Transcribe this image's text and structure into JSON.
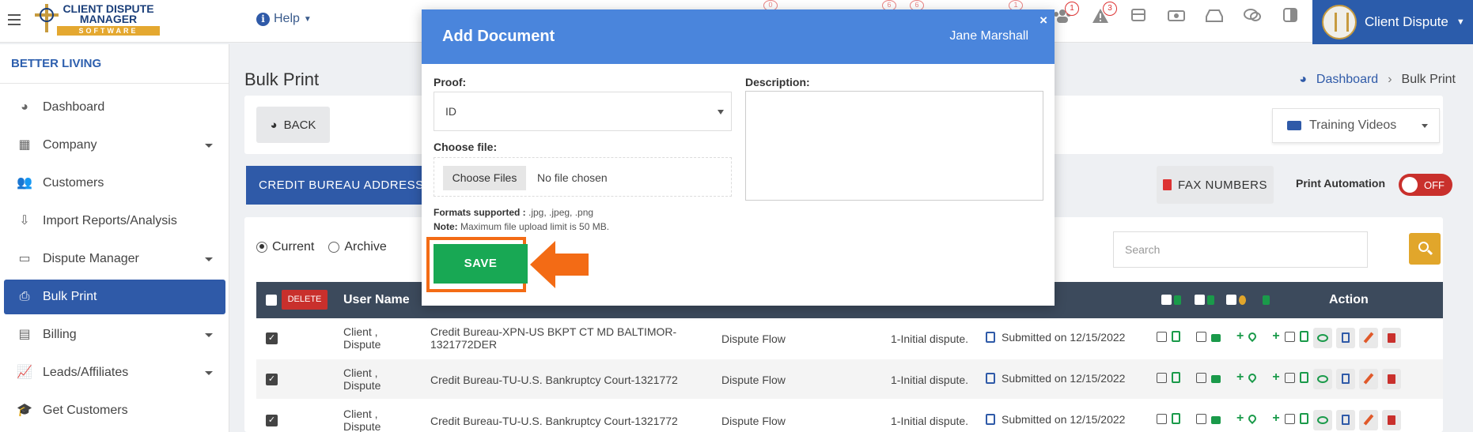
{
  "app": {
    "logo_line1": "CLIENT DISPUTE",
    "logo_line2": "MANAGER",
    "logo_line3": "SOFTWARE",
    "help_label": "Help",
    "user_name": "Client Dispute"
  },
  "topbar": {
    "badges": [
      "1",
      "3"
    ],
    "ghost_badges": [
      "0",
      "6",
      "6",
      "1"
    ],
    "icons": [
      "users-icon",
      "alert-icon",
      "archive-icon",
      "money-icon",
      "inbox-icon",
      "chat-icon",
      "collapse-icon"
    ]
  },
  "sidebar": {
    "org": "BETTER LIVING",
    "items": [
      {
        "label": "Dashboard",
        "icon": "pie-icon"
      },
      {
        "label": "Company",
        "icon": "building-icon",
        "has_caret": true
      },
      {
        "label": "Customers",
        "icon": "users-icon"
      },
      {
        "label": "Import Reports/Analysis",
        "icon": "import-icon"
      },
      {
        "label": "Dispute Manager",
        "icon": "monitor-icon",
        "has_caret": true
      },
      {
        "label": "Bulk Print",
        "icon": "printer-icon",
        "active": true
      },
      {
        "label": "Billing",
        "icon": "billing-icon",
        "has_caret": true
      },
      {
        "label": "Leads/Affiliates",
        "icon": "chart-icon",
        "has_caret": true
      },
      {
        "label": "Get Customers",
        "icon": "graduation-icon"
      }
    ]
  },
  "page": {
    "title": "Bulk Print",
    "breadcrumb": [
      "Dashboard",
      "Bulk Print"
    ],
    "back_label": "BACK",
    "training_label": "Training Videos",
    "bureau_label": "CREDIT BUREAU ADDRESS",
    "fax_label": "FAX NUMBERS",
    "automation_label": "Print Automation",
    "toggle_label": "OFF",
    "radio_current": "Current",
    "radio_archive": "Archive",
    "search_placeholder": "Search"
  },
  "table": {
    "delete_label": "DELETE",
    "header_user": "User Name",
    "header_action": "Action",
    "rows": [
      {
        "user": "Client , Dispute",
        "bureau": "Credit Bureau-XPN-US BKPT CT MD BALTIMOR-1321772DER",
        "flow": "Dispute Flow",
        "dispute": "1-Initial dispute.",
        "status": "Submitted on 12/15/2022"
      },
      {
        "user": "Client , Dispute",
        "bureau": "Credit Bureau-TU-U.S. Bankruptcy Court-1321772",
        "flow": "Dispute Flow",
        "dispute": "1-Initial dispute.",
        "status": "Submitted on 12/15/2022"
      },
      {
        "user": "Client , Dispute",
        "bureau": "Credit Bureau-TU-U.S. Bankruptcy Court-1321772",
        "flow": "Dispute Flow",
        "dispute": "1-Initial dispute.",
        "status": "Submitted on 12/15/2022"
      }
    ]
  },
  "modal": {
    "title": "Add Document",
    "user": "Jane Marshall",
    "close": "×",
    "proof_label": "Proof:",
    "proof_value": "ID",
    "description_label": "Description:",
    "choose_file_label": "Choose file:",
    "choose_files_button": "Choose Files",
    "no_file": "No file chosen",
    "formats_label": "Formats supported :",
    "formats_value": " .jpg, .jpeg, .png",
    "note_label": "Note:",
    "note_value": " Maximum file upload limit is 50 MB.",
    "save_label": "SAVE"
  },
  "colors": {
    "primary": "#2f5aa8",
    "modal_header": "#4a85dc",
    "save_green": "#18a854",
    "highlight_orange": "#f36b15",
    "danger": "#c9302c",
    "gold": "#e1a62b"
  }
}
